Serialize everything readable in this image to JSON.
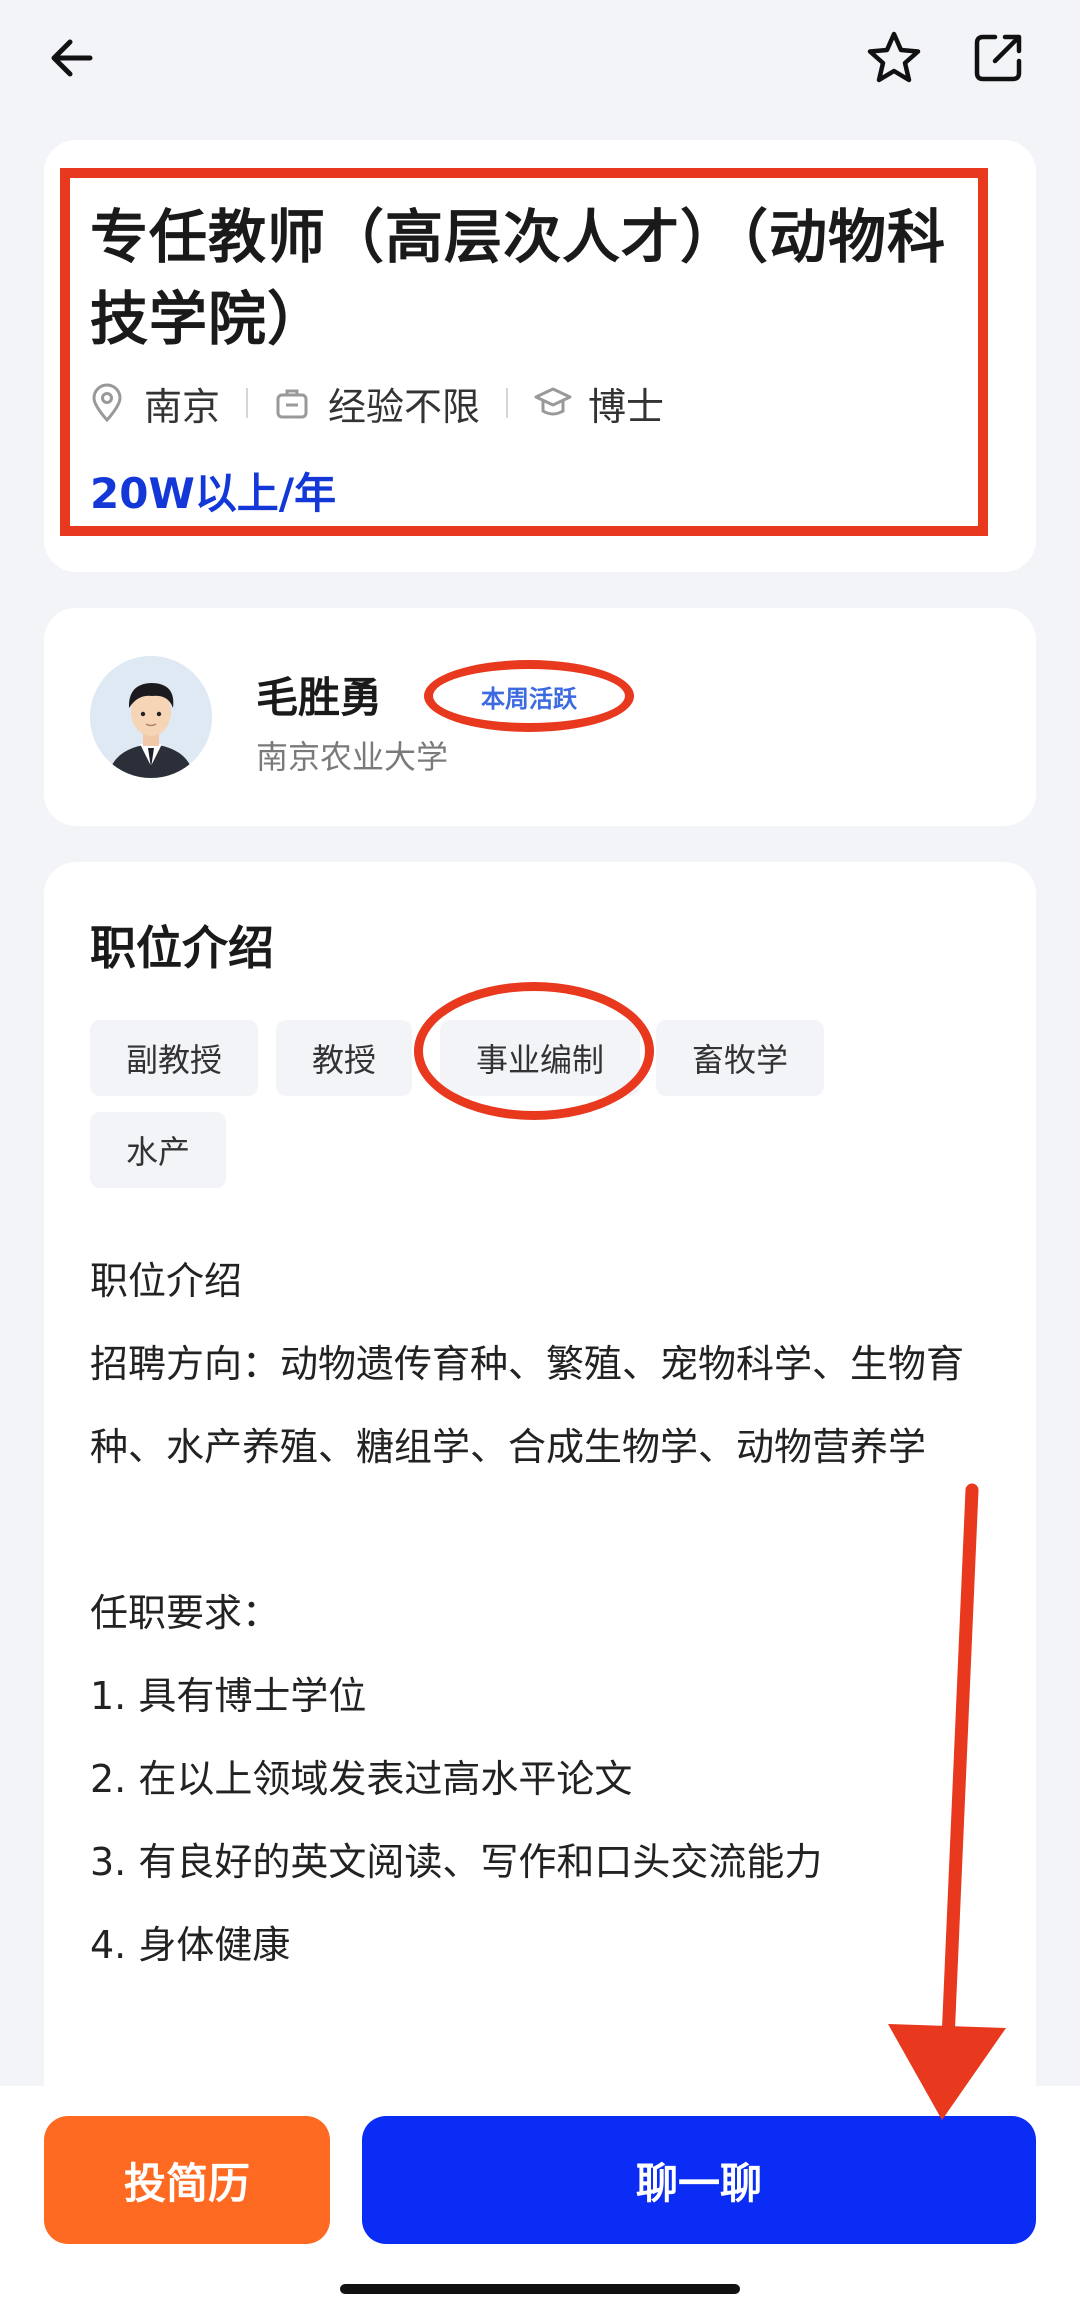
{
  "topbar": {
    "back_icon": "arrow-left-icon",
    "star_icon": "star-outline-icon",
    "share_icon": "share-external-icon"
  },
  "job": {
    "title": "专任教师（高层次人才）（动物科技学院）",
    "location": "南京",
    "experience": "经验不限",
    "education": "博士",
    "salary": "20W以上/年"
  },
  "hr": {
    "name": "毛胜勇",
    "badge": "本周活跃",
    "school": "南京农业大学"
  },
  "description": {
    "heading": "职位介绍",
    "tags": [
      "副教授",
      "教授",
      "事业编制",
      "畜牧学",
      "水产"
    ],
    "text": "职位介绍\n招聘方向：动物遗传育种、繁殖、宠物科学、生物育种、水产养殖、糖组学、合成生物学、动物营养学\n\n任职要求：\n1. 具有博士学位\n2. 在以上领域发表过高水平论文\n3. 有良好的英文阅读、写作和口头交流能力\n4. 身体健康"
  },
  "actions": {
    "resume": "投简历",
    "chat": "聊一聊"
  },
  "colors": {
    "salary": "#1438d8",
    "annotation_red": "#e8381e",
    "resume_btn": "#fe6a21",
    "chat_btn": "#0b2cf4"
  }
}
